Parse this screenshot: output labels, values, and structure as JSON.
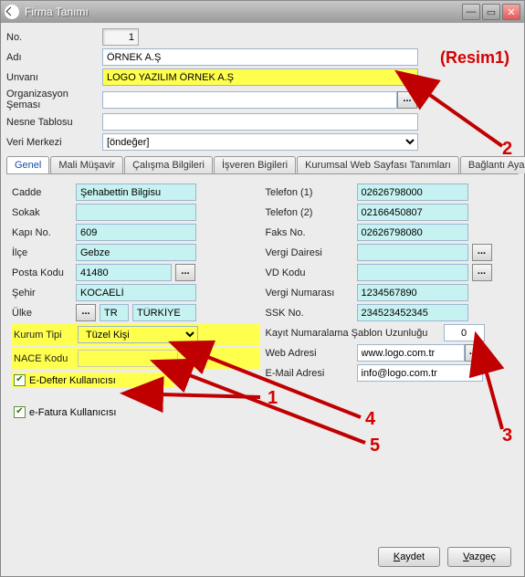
{
  "window": {
    "title": "Firma Tanımı"
  },
  "resim_label": "(Resim1)",
  "header": {
    "no_label": "No.",
    "no": "1",
    "adi_label": "Adı",
    "adi": "ÖRNEK A.Ş",
    "unvani_label": "Unvanı",
    "unvani": "LOGO YAZILIM ÖRNEK A.Ş",
    "org_label": "Organizasyon Şeması",
    "org": "",
    "nesne_label": "Nesne Tablosu",
    "nesne": "",
    "veri_label": "Veri Merkezi",
    "veri": "[öndeğer]"
  },
  "tabs": [
    {
      "label": "Genel"
    },
    {
      "label": "Mali Müşavir"
    },
    {
      "label": "Çalışma Bilgileri"
    },
    {
      "label": "İşveren Bigileri"
    },
    {
      "label": "Kurumsal Web Sayfası Tanımları"
    },
    {
      "label": "Bağlantı Ayarları"
    }
  ],
  "left": {
    "cadde_label": "Cadde",
    "cadde": "Şehabettin Bilgisu",
    "sokak_label": "Sokak",
    "sokak": "",
    "kapi_label": "Kapı No.",
    "kapi": "609",
    "ilce_label": "İlçe",
    "ilce": "Gebze",
    "posta_label": "Posta Kodu",
    "posta": "41480",
    "sehir_label": "Şehir",
    "sehir": "KOCAELİ",
    "ulke_label": "Ülke",
    "ulke1": "TR",
    "ulke2": "TÜRKİYE",
    "kurum_label": "Kurum Tipi",
    "kurum": "Tüzel Kişi",
    "nace_label": "NACE Kodu",
    "nace": "",
    "edefter_label": "E-Defter Kullanıcısı",
    "efatura_label": "e-Fatura Kullanıcısı"
  },
  "right": {
    "tel1_label": "Telefon (1)",
    "tel1": "02626798000",
    "tel2_label": "Telefon (2)",
    "tel2": "02166450807",
    "faks_label": "Faks No.",
    "faks": "02626798080",
    "vd_label": "Vergi Dairesi",
    "vd": "",
    "vdk_label": "VD Kodu",
    "vdk": "",
    "vn_label": "Vergi Numarası",
    "vn": "1234567890",
    "ssk_label": "SSK No.",
    "ssk": "234523452345",
    "kayit_label": "Kayıt Numaralama Şablon Uzunluğu",
    "kayit": "0",
    "web_label": "Web Adresi",
    "web": "www.logo.com.tr",
    "email_label": "E-Mail Adresi",
    "email": "info@logo.com.tr"
  },
  "buttons": {
    "save": "Kaydet",
    "cancel": "Vazgeç"
  },
  "annotations": {
    "n1": "1",
    "n2": "2",
    "n3": "3",
    "n4": "4",
    "n5": "5"
  }
}
